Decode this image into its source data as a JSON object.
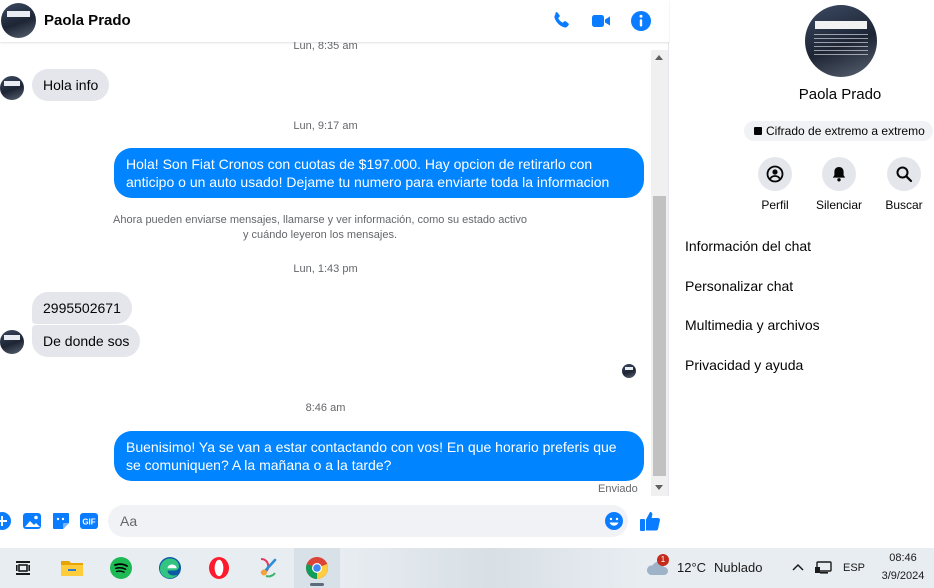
{
  "colors": {
    "accent": "#0084ff",
    "incoming_bubble": "#e4e6eb",
    "icon_blue": "#0a7cff",
    "muted_text": "#65676b"
  },
  "chat": {
    "header": {
      "name": "Paola Prado",
      "icons": [
        "phone-icon",
        "video-camera-icon",
        "info-icon"
      ]
    },
    "top_timestamp_partial": "Lun, 8:35 am",
    "messages": [
      {
        "type": "incoming",
        "text": "Hola info"
      },
      {
        "type": "timestamp",
        "text": "Lun, 9:17 am"
      },
      {
        "type": "outgoing",
        "text": "Hola! Son Fiat Cronos con cuotas de $197.000. Hay opcion de retirarlo con anticipo o un auto usado! Dejame tu numero para enviarte toda la informacion"
      },
      {
        "type": "system",
        "line1": "Ahora pueden enviarse mensajes, llamarse y ver información, como su estado activo",
        "line2": "y cuándo leyeron los mensajes."
      },
      {
        "type": "timestamp",
        "text": "Lun, 1:43 pm"
      },
      {
        "type": "incoming",
        "text": "2995502671"
      },
      {
        "type": "incoming",
        "text": "De donde sos"
      },
      {
        "type": "timestamp",
        "text": "8:46 am"
      },
      {
        "type": "outgoing",
        "text": "Buenisimo! Ya se van a estar contactando con vos! En que horario preferis que se comuniquen? A la mañana o a la tarde?"
      }
    ],
    "sent_status": "Enviado",
    "composer": {
      "placeholder": "Aa",
      "icons": [
        "plus-icon",
        "image-icon",
        "sticker-icon",
        "gif-icon",
        "emoji-icon",
        "thumbs-up-icon"
      ]
    }
  },
  "info_pane": {
    "name": "Paola Prado",
    "encryption_badge": "Cifrado de extremo a extremo",
    "actions": [
      {
        "label": "Perfil",
        "icon": "profile-icon"
      },
      {
        "label": "Silenciar",
        "icon": "bell-icon"
      },
      {
        "label": "Buscar",
        "icon": "search-icon"
      }
    ],
    "sections": [
      "Información del chat",
      "Personalizar chat",
      "Multimedia y archivos",
      "Privacidad y ayuda"
    ]
  },
  "taskbar": {
    "apps": [
      "task-view",
      "file-explorer",
      "spotify",
      "edge",
      "opera",
      "paint",
      "chrome"
    ],
    "weather": {
      "notification_count": "1",
      "temperature": "12°C",
      "condition": "Nublado"
    },
    "language": "ESP",
    "time": "08:46",
    "date": "3/9/2024"
  }
}
